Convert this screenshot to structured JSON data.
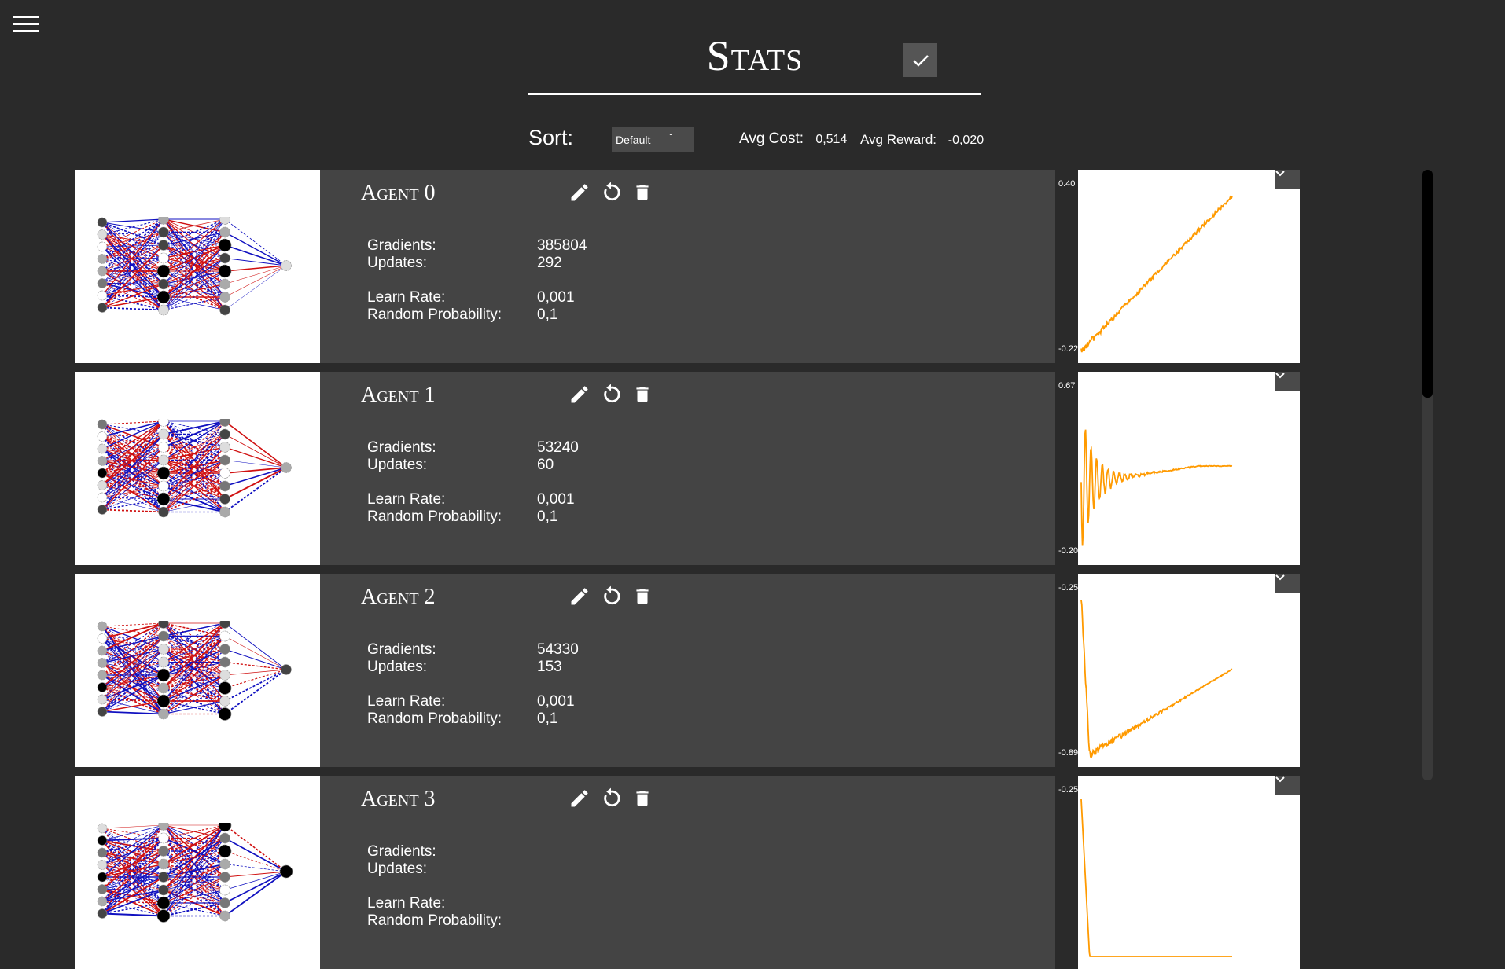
{
  "header": {
    "title": "Stats",
    "sort_label": "Sort:",
    "sort_value": "Default"
  },
  "summary": {
    "avg_cost_label": "Avg Cost:",
    "avg_cost": "0,514",
    "avg_reward_label": "Avg Reward:",
    "avg_reward": "-0,020"
  },
  "labels": {
    "gradients": "Gradients:",
    "updates": "Updates:",
    "learn_rate": "Learn Rate:",
    "random_probability": "Random Probability:"
  },
  "icons": {
    "menu": "hamburger-menu-icon",
    "confirm": "checkmark-icon",
    "edit": "pencil-icon",
    "reset": "reset-icon",
    "delete": "trash-icon",
    "dropdown": "chevron-down-icon"
  },
  "colors": {
    "background": "#2a2a2a",
    "panel": "#444444",
    "line": "#ff9a00",
    "edge_positive": "#d01010",
    "edge_negative": "#1010c0"
  },
  "agents": [
    {
      "name": "Agent 0",
      "gradients": "385804",
      "updates": "292",
      "learn_rate": "0,001",
      "random_probability": "0,1",
      "plot_max": "0.40",
      "plot_min": "-0.22"
    },
    {
      "name": "Agent 1",
      "gradients": "53240",
      "updates": "60",
      "learn_rate": "0,001",
      "random_probability": "0,1",
      "plot_max": "0.67",
      "plot_min": "-0.20"
    },
    {
      "name": "Agent 2",
      "gradients": "54330",
      "updates": "153",
      "learn_rate": "0,001",
      "random_probability": "0,1",
      "plot_max": "-0.25",
      "plot_min": "-0.89"
    },
    {
      "name": "Agent 3",
      "gradients": "",
      "updates": "",
      "learn_rate": "",
      "random_probability": "",
      "plot_max": "-0.25",
      "plot_min": ""
    }
  ]
}
